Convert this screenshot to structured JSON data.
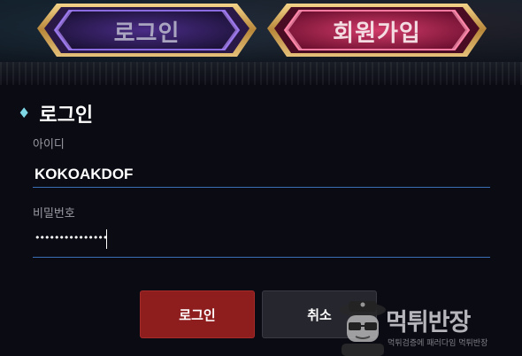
{
  "tabs": {
    "login_label": "로그인",
    "signup_label": "회원가입"
  },
  "section": {
    "title": "로그인"
  },
  "form": {
    "id_label": "아이디",
    "id_value": "KOKOAKDOF",
    "password_label": "비밀번호",
    "password_mask": "•••••••••••••••"
  },
  "buttons": {
    "login_label": "로그인",
    "cancel_label": "취소"
  },
  "watermark": {
    "title": "먹튀반장",
    "subtitle": "먹튀검증에 패러다임 먹튀반장"
  },
  "colors": {
    "accent_diamond": "#7fd7e5",
    "login_button": "#8e1d1e",
    "cancel_button": "#26262e",
    "input_underline": "#3b6fb5"
  },
  "icons": {
    "section_marker": "diamond-icon",
    "watermark": "detective-mascot-icon"
  }
}
